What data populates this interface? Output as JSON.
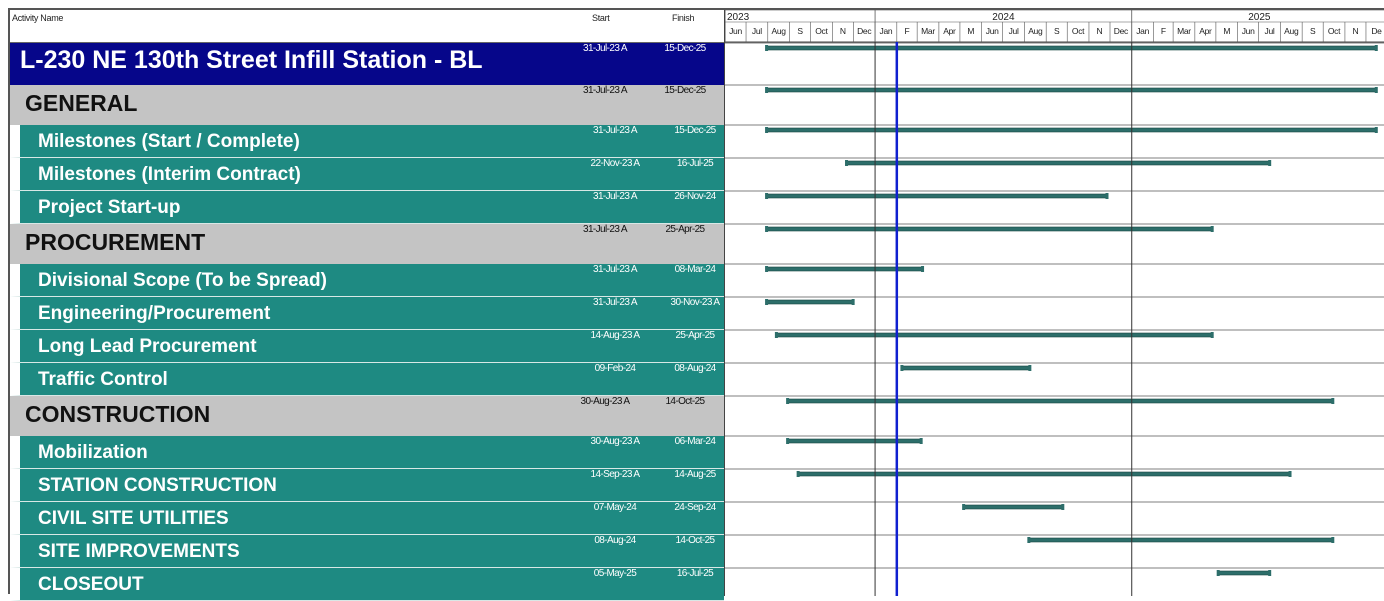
{
  "header": {
    "activity_name": "Activity Name",
    "start": "Start",
    "finish": "Finish"
  },
  "chart_data": {
    "type": "gantt",
    "timescale": {
      "years": [
        "2023",
        "2024",
        "2025"
      ],
      "months_2023": [
        "Jun",
        "Jul",
        "Aug",
        "S",
        "Oct",
        "N",
        "Dec"
      ],
      "months_2024": [
        "Jan",
        "F",
        "Mar",
        "Apr",
        "M",
        "Jun",
        "Jul",
        "Aug",
        "S",
        "Oct",
        "N",
        "Dec"
      ],
      "months_2025": [
        "Jan",
        "F",
        "Mar",
        "Apr",
        "M",
        "Jun",
        "Jul",
        "Aug",
        "S",
        "Oct",
        "N",
        "De"
      ],
      "range": [
        "2023-06-01",
        "2025-12-31"
      ],
      "data_date": "2024-02-01"
    },
    "rows": [
      {
        "level": "project",
        "name": "L-230 NE 130th Street Infill Station - BL",
        "start": "31-Jul-23 A",
        "finish": "15-Dec-25",
        "start_date": "2023-07-31",
        "finish_date": "2025-12-15"
      },
      {
        "level": "section",
        "name": "GENERAL",
        "start": "31-Jul-23 A",
        "finish": "15-Dec-25",
        "start_date": "2023-07-31",
        "finish_date": "2025-12-15"
      },
      {
        "level": "item",
        "name": "Milestones (Start / Complete)",
        "start": "31-Jul-23 A",
        "finish": "15-Dec-25",
        "start_date": "2023-07-31",
        "finish_date": "2025-12-15"
      },
      {
        "level": "item",
        "name": "Milestones (Interim Contract)",
        "start": "22-Nov-23 A",
        "finish": "16-Jul-25",
        "start_date": "2023-11-22",
        "finish_date": "2025-07-16"
      },
      {
        "level": "item",
        "name": "Project Start-up",
        "start": "31-Jul-23 A",
        "finish": "26-Nov-24",
        "start_date": "2023-07-31",
        "finish_date": "2024-11-26"
      },
      {
        "level": "section",
        "name": "PROCUREMENT",
        "start": "31-Jul-23 A",
        "finish": "25-Apr-25",
        "start_date": "2023-07-31",
        "finish_date": "2025-04-25"
      },
      {
        "level": "item",
        "name": "Divisional Scope  (To be Spread)",
        "start": "31-Jul-23 A",
        "finish": "08-Mar-24",
        "start_date": "2023-07-31",
        "finish_date": "2024-03-08"
      },
      {
        "level": "item",
        "name": "Engineering/Procurement",
        "start": "31-Jul-23 A",
        "finish": "30-Nov-23 A",
        "start_date": "2023-07-31",
        "finish_date": "2023-11-30"
      },
      {
        "level": "item",
        "name": "Long Lead Procurement",
        "start": "14-Aug-23 A",
        "finish": "25-Apr-25",
        "start_date": "2023-08-14",
        "finish_date": "2025-04-25"
      },
      {
        "level": "item",
        "name": "Traffic Control",
        "start": "09-Feb-24",
        "finish": "08-Aug-24",
        "start_date": "2024-02-09",
        "finish_date": "2024-08-08"
      },
      {
        "level": "section",
        "name": "CONSTRUCTION",
        "start": "30-Aug-23 A",
        "finish": "14-Oct-25",
        "start_date": "2023-08-30",
        "finish_date": "2025-10-14"
      },
      {
        "level": "item",
        "name": "Mobilization",
        "start": "30-Aug-23 A",
        "finish": "06-Mar-24",
        "start_date": "2023-08-30",
        "finish_date": "2024-03-06"
      },
      {
        "level": "item",
        "name": "STATION CONSTRUCTION",
        "start": "14-Sep-23 A",
        "finish": "14-Aug-25",
        "start_date": "2023-09-14",
        "finish_date": "2025-08-14"
      },
      {
        "level": "item",
        "name": "CIVIL SITE UTILITIES",
        "start": "07-May-24",
        "finish": "24-Sep-24",
        "start_date": "2024-05-07",
        "finish_date": "2024-09-24"
      },
      {
        "level": "item",
        "name": "SITE IMPROVEMENTS",
        "start": "08-Aug-24",
        "finish": "14-Oct-25",
        "start_date": "2024-08-08",
        "finish_date": "2025-10-14"
      },
      {
        "level": "item",
        "name": "CLOSEOUT",
        "start": "05-May-25",
        "finish": "16-Jul-25",
        "start_date": "2025-05-05",
        "finish_date": "2025-07-16"
      }
    ],
    "colors": {
      "project_band": "#06068a",
      "section_band": "#c4c4c4",
      "item_band": "#1e8a82",
      "bar": "#2d6e6a",
      "data_date_line": "#1020d0"
    }
  }
}
